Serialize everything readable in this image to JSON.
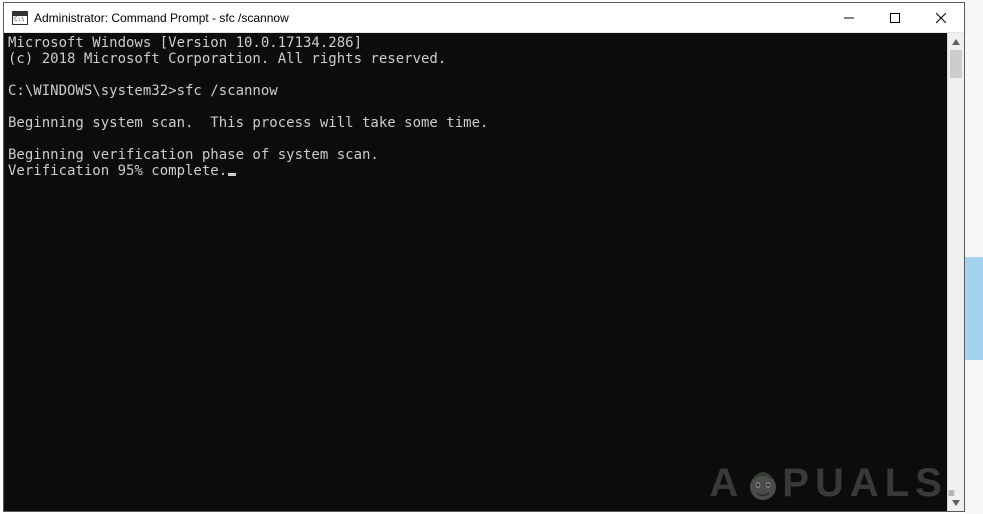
{
  "window": {
    "title": "Administrator: Command Prompt - sfc  /scannow"
  },
  "terminal": {
    "line1": "Microsoft Windows [Version 10.0.17134.286]",
    "line2": "(c) 2018 Microsoft Corporation. All rights reserved.",
    "blank1": "",
    "prompt": "C:\\WINDOWS\\system32>sfc /scannow",
    "blank2": "",
    "scan_begin": "Beginning system scan.  This process will take some time.",
    "blank3": "",
    "verify_begin": "Beginning verification phase of system scan.",
    "verify_progress": "Verification 95% complete."
  },
  "watermark": {
    "left": "A",
    "right": "PUALS",
    "dot": "."
  }
}
